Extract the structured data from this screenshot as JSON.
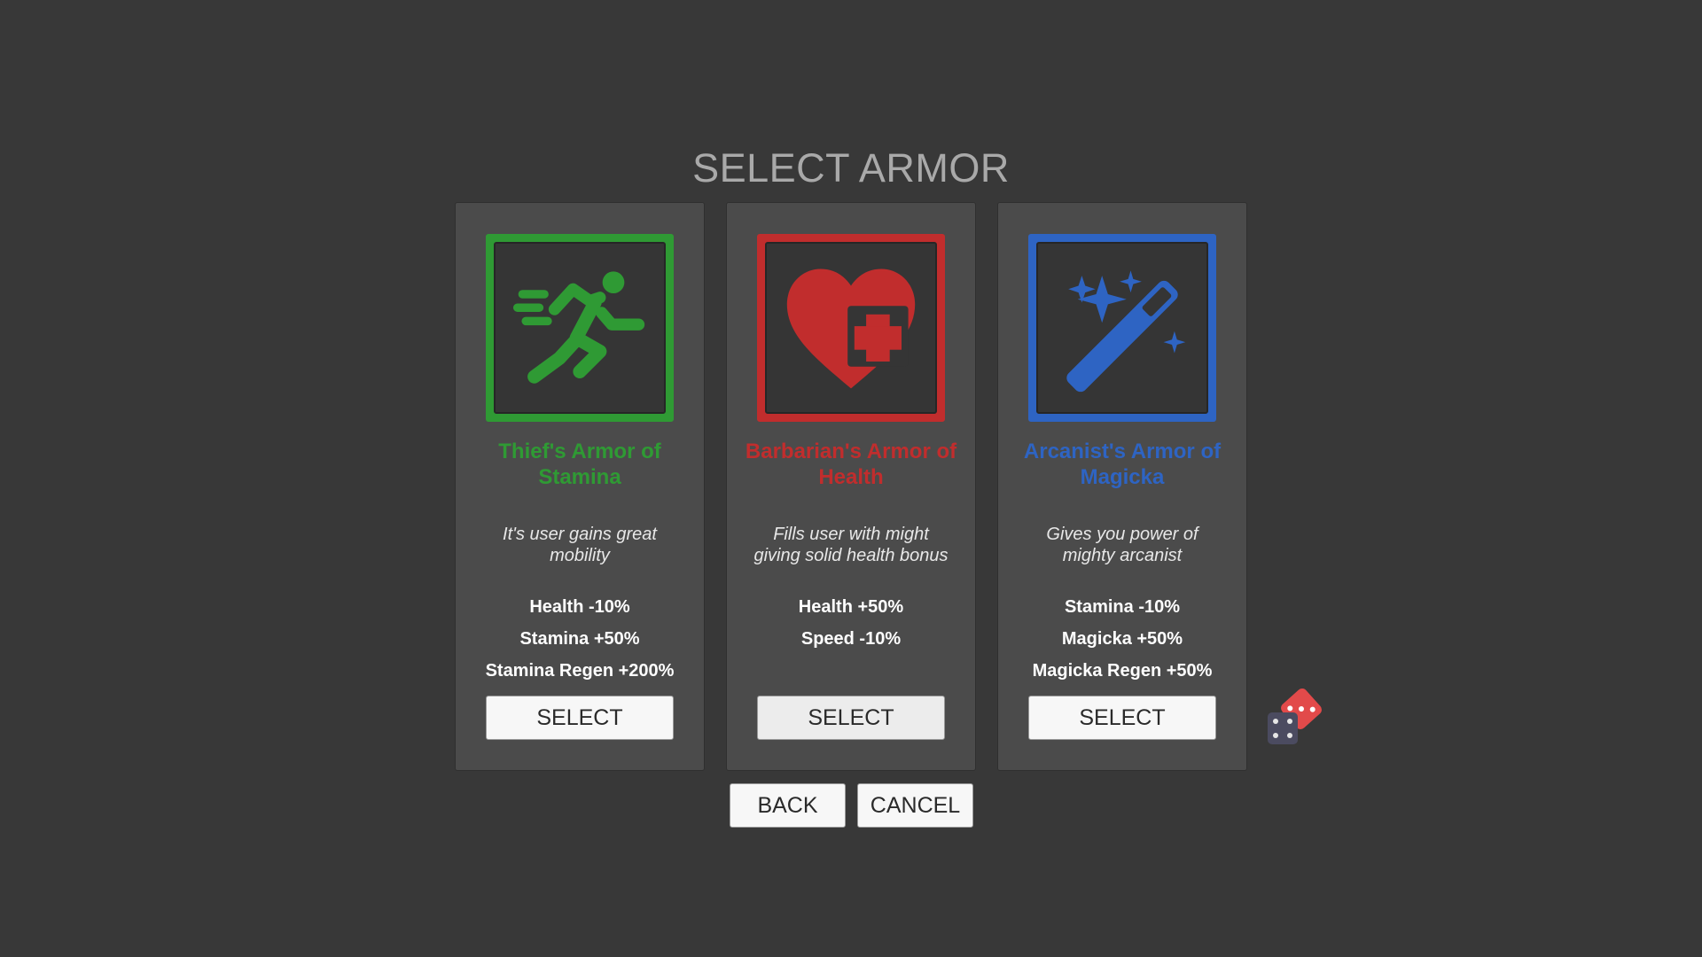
{
  "page": {
    "title": "SELECT ARMOR"
  },
  "cards": [
    {
      "name": "Thief's Armor of Stamina",
      "description": "It's user gains great mobility",
      "stats": [
        "Health -10%",
        "Stamina +50%",
        "Stamina Regen +200%"
      ],
      "select_label": "SELECT",
      "icon": "running-person-icon",
      "accent": "#2f9a34"
    },
    {
      "name": "Barbarian's Armor of Health",
      "description": "Fills user with might giving solid health bonus",
      "stats": [
        "Health +50%",
        "Speed -10%"
      ],
      "select_label": "SELECT",
      "icon": "heart-plus-icon",
      "accent": "#c12d2d"
    },
    {
      "name": "Arcanist's Armor of Magicka",
      "description": "Gives you power of mighty arcanist",
      "stats": [
        "Stamina -10%",
        "Magicka +50%",
        "Magicka Regen +50%"
      ],
      "select_label": "SELECT",
      "icon": "magic-wand-icon",
      "accent": "#2e64c3"
    }
  ],
  "footer": {
    "back_label": "BACK",
    "cancel_label": "CANCEL"
  },
  "randomize": {
    "icon": "dice-icon"
  }
}
